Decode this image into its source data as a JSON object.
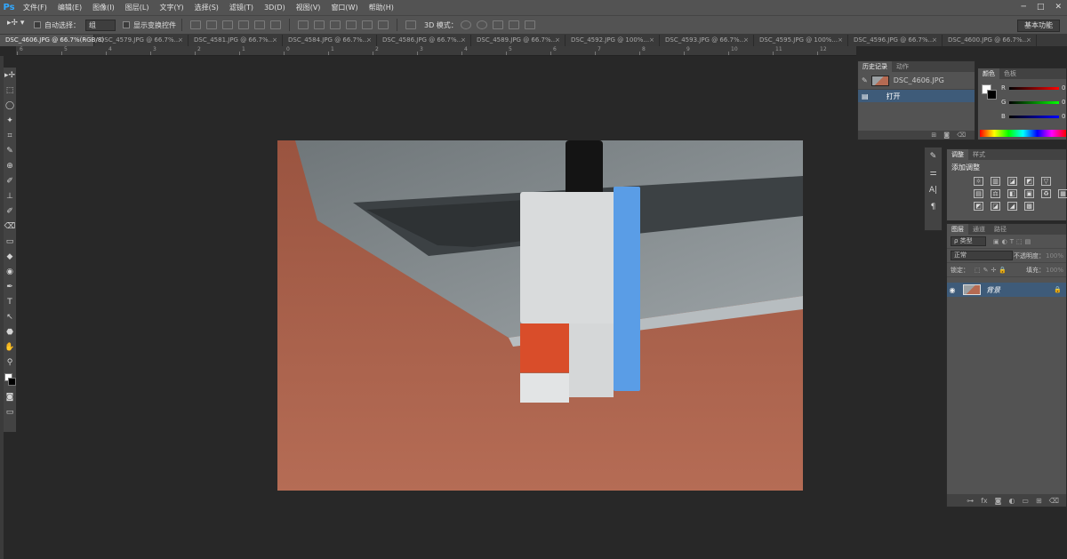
{
  "menubar": {
    "logo": "Ps",
    "items": [
      "文件(F)",
      "编辑(E)",
      "图像(I)",
      "图层(L)",
      "文字(Y)",
      "选择(S)",
      "滤镜(T)",
      "3D(D)",
      "视图(V)",
      "窗口(W)",
      "帮助(H)"
    ],
    "window_controls": [
      "─",
      "□",
      "✕"
    ]
  },
  "options": {
    "auto_select_label": "自动选择：",
    "auto_select_value": "组",
    "show_transform_label": "显示变换控件",
    "mode_3d_label": "3D 模式：",
    "workspace_label": "基本功能"
  },
  "tabs": [
    {
      "label": "DSC_4606.JPG @ 66.7%(RGB/8)",
      "active": true
    },
    {
      "label": "DSC_4579.JPG @ 66.7%..."
    },
    {
      "label": "DSC_4581.JPG @ 66.7%..."
    },
    {
      "label": "DSC_4584.JPG @ 66.7%..."
    },
    {
      "label": "DSC_4586.JPG @ 66.7%..."
    },
    {
      "label": "DSC_4589.JPG @ 66.7%..."
    },
    {
      "label": "DSC_4592.JPG @ 100%..."
    },
    {
      "label": "DSC_4593.JPG @ 66.7%..."
    },
    {
      "label": "DSC_4595.JPG @ 100%..."
    },
    {
      "label": "DSC_4596.JPG @ 66.7%..."
    },
    {
      "label": "DSC_4600.JPG @ 66.7%..."
    }
  ],
  "tab_close": "×",
  "ruler_numbers": [
    "6",
    "5",
    "4",
    "3",
    "2",
    "1",
    "0",
    "1",
    "2",
    "3",
    "4",
    "5",
    "6",
    "7",
    "8",
    "9",
    "10",
    "11",
    "12",
    "13",
    "14",
    "15",
    "16",
    "17"
  ],
  "tools": [
    "▸✢",
    "⬚",
    "◯",
    "✦",
    "⌗",
    "✎",
    "⊕",
    "✐",
    "⊥",
    "✐",
    "⌫",
    "▭",
    "◆",
    "◉",
    "✒",
    "T",
    "↖",
    "⬣",
    "✋",
    "⚲"
  ],
  "tool_names": [
    "move-icon",
    "marquee-icon",
    "lasso-icon",
    "magic-wand-icon",
    "crop-icon",
    "eyedropper-icon",
    "healing-icon",
    "brush-icon",
    "stamp-icon",
    "history-brush-icon",
    "eraser-icon",
    "gradient-icon",
    "blur-icon",
    "dodge-icon",
    "pen-icon",
    "type-icon",
    "path-select-icon",
    "shape-icon",
    "hand-icon",
    "zoom-icon"
  ],
  "history": {
    "tabs": [
      "历史记录",
      "动作"
    ],
    "snapshot_name": "DSC_4606.JPG",
    "steps": [
      "打开"
    ]
  },
  "color_panel": {
    "tabs": [
      "颜色",
      "色板"
    ],
    "channels": [
      {
        "label": "R",
        "value": "0",
        "color": "#c02020"
      },
      {
        "label": "G",
        "value": "0",
        "color": "#20a020"
      },
      {
        "label": "B",
        "value": "0",
        "color": "#2050c0"
      }
    ]
  },
  "adjustments": {
    "tabs": [
      "调整",
      "样式"
    ],
    "title": "添加调整",
    "icons": [
      "☼",
      "▥",
      "◪",
      "◩",
      "▽",
      "",
      "▤",
      "⚖",
      "◧",
      "▣",
      "♻",
      "▦",
      "◩",
      "◪",
      "◢",
      "▩"
    ]
  },
  "layers": {
    "tabs": [
      "图层",
      "通道",
      "路径"
    ],
    "filter_label": "ρ 类型",
    "blend_mode": "正常",
    "opacity_label": "不透明度：",
    "opacity_value": "100%",
    "lock_label": "锁定：",
    "fill_label": "填充：",
    "fill_value": "100%",
    "items": [
      {
        "name": "背景"
      }
    ],
    "footer_icons": [
      "⊶",
      "fx",
      "◙",
      "◐",
      "▭",
      "⊞",
      "⌫"
    ]
  }
}
